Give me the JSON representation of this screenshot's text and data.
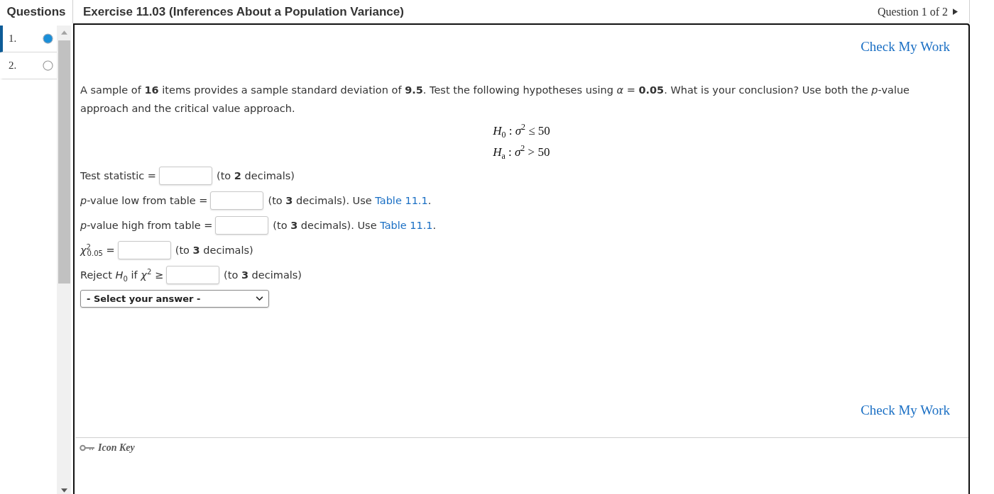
{
  "header": {
    "panel_title": "Questions",
    "exercise_title": "Exercise 11.03 (Inferences About a Population Variance)",
    "question_counter": "Question 1 of 2"
  },
  "questions": [
    {
      "number": "1.",
      "selected": true
    },
    {
      "number": "2.",
      "selected": false
    }
  ],
  "check_work_top": "Check My Work",
  "problem": "A sample of **16** items provides a sample standard deviation of **9.5**. Test the following hypotheses using *α* = **0.05**. What is your conclusion? Use both the *p*-value approach and the critical value approach.",
  "hypotheses": [
    "*H*$_{0}$ : *σ*$^{2}$ ≤ 50",
    "*H*$_{a}$ : *σ*$^{2}$ > 50"
  ],
  "answer_rows": [
    {
      "label": "Test statistic =",
      "hint": "(to **2** decimals)"
    },
    {
      "label": "*p*-value low from table =",
      "hint": "(to **3** decimals). Use",
      "link": "Table 11.1",
      "hint_end": "."
    },
    {
      "label": "*p*-value high from table =",
      "hint": "(to **3** decimals). Use",
      "link": "Table 11.1",
      "hint_end": "."
    },
    {
      "label": "*χ*$^{2}$$_{0.05}$ =",
      "hint": "(to **3** decimals)"
    },
    {
      "label": "Reject *H*$_{0}$ if *χ*$^{2}$ ≥",
      "hint": "(to **3** decimals)"
    }
  ],
  "conclusion_select": {
    "value": "- Select your answer -"
  },
  "check_work_bottom": "Check My Work",
  "icon_key": "Icon Key"
}
